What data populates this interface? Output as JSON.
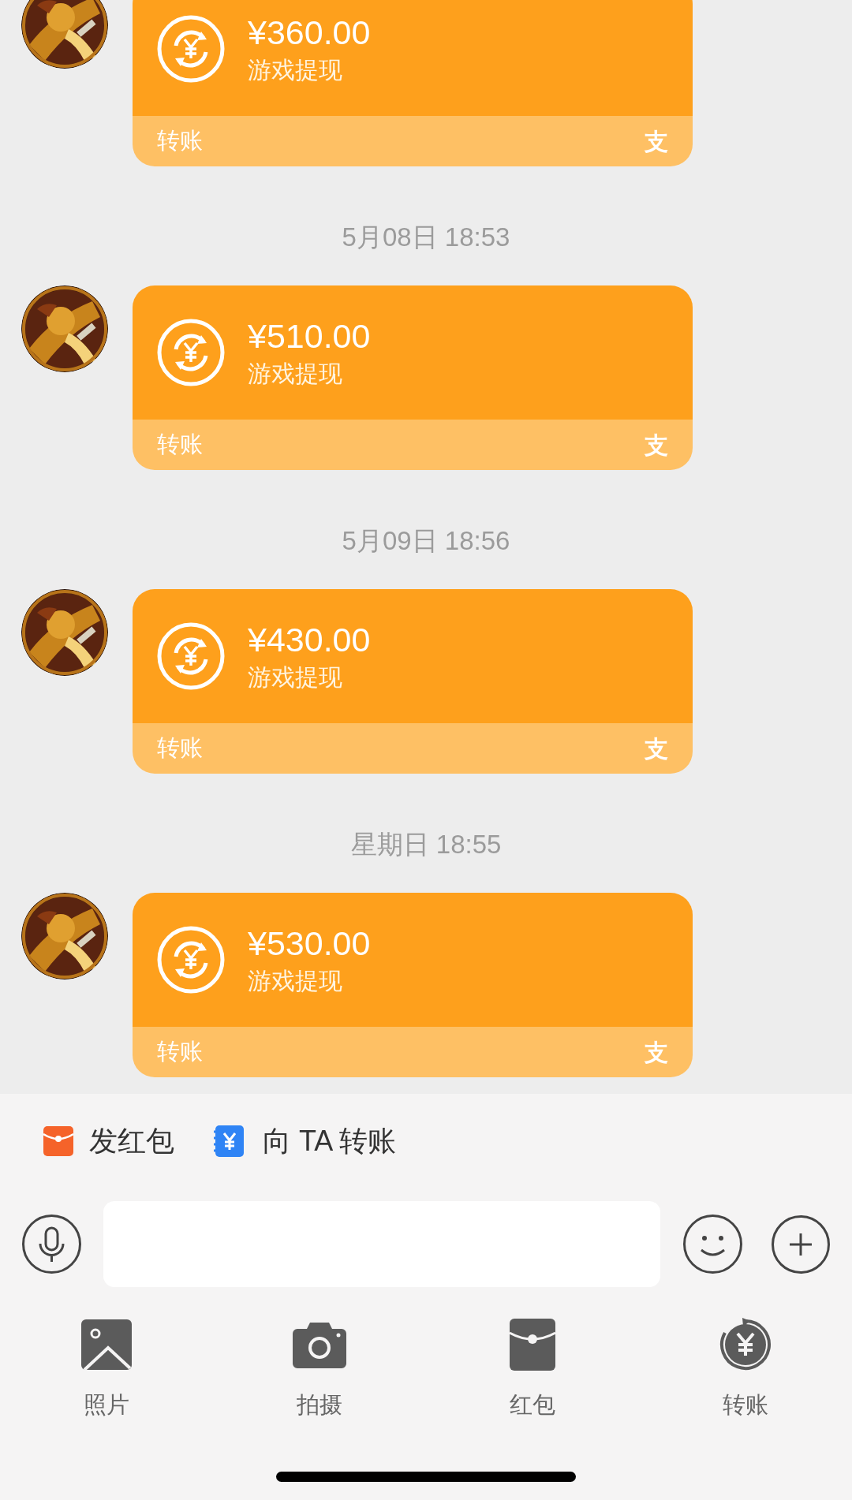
{
  "messages": [
    {
      "amount": "¥360.00",
      "memo": "游戏提现",
      "footer_label": "转账",
      "brand_mark": "支"
    },
    {
      "timestamp": "5月08日 18:53",
      "amount": "¥510.00",
      "memo": "游戏提现",
      "footer_label": "转账",
      "brand_mark": "支"
    },
    {
      "timestamp": "5月09日 18:56",
      "amount": "¥430.00",
      "memo": "游戏提现",
      "footer_label": "转账",
      "brand_mark": "支"
    },
    {
      "timestamp": "星期日 18:55",
      "amount": "¥530.00",
      "memo": "游戏提现",
      "footer_label": "转账",
      "brand_mark": "支"
    }
  ],
  "quick_actions": [
    {
      "kind": "red-packet",
      "label": "发红包"
    },
    {
      "kind": "transfer",
      "label": "向 TA 转账"
    }
  ],
  "tools": [
    {
      "label": "照片"
    },
    {
      "kind": "camera",
      "label": "拍摄"
    },
    {
      "kind": "red-packet",
      "label": "红包"
    },
    {
      "kind": "transfer",
      "label": "转账"
    }
  ]
}
